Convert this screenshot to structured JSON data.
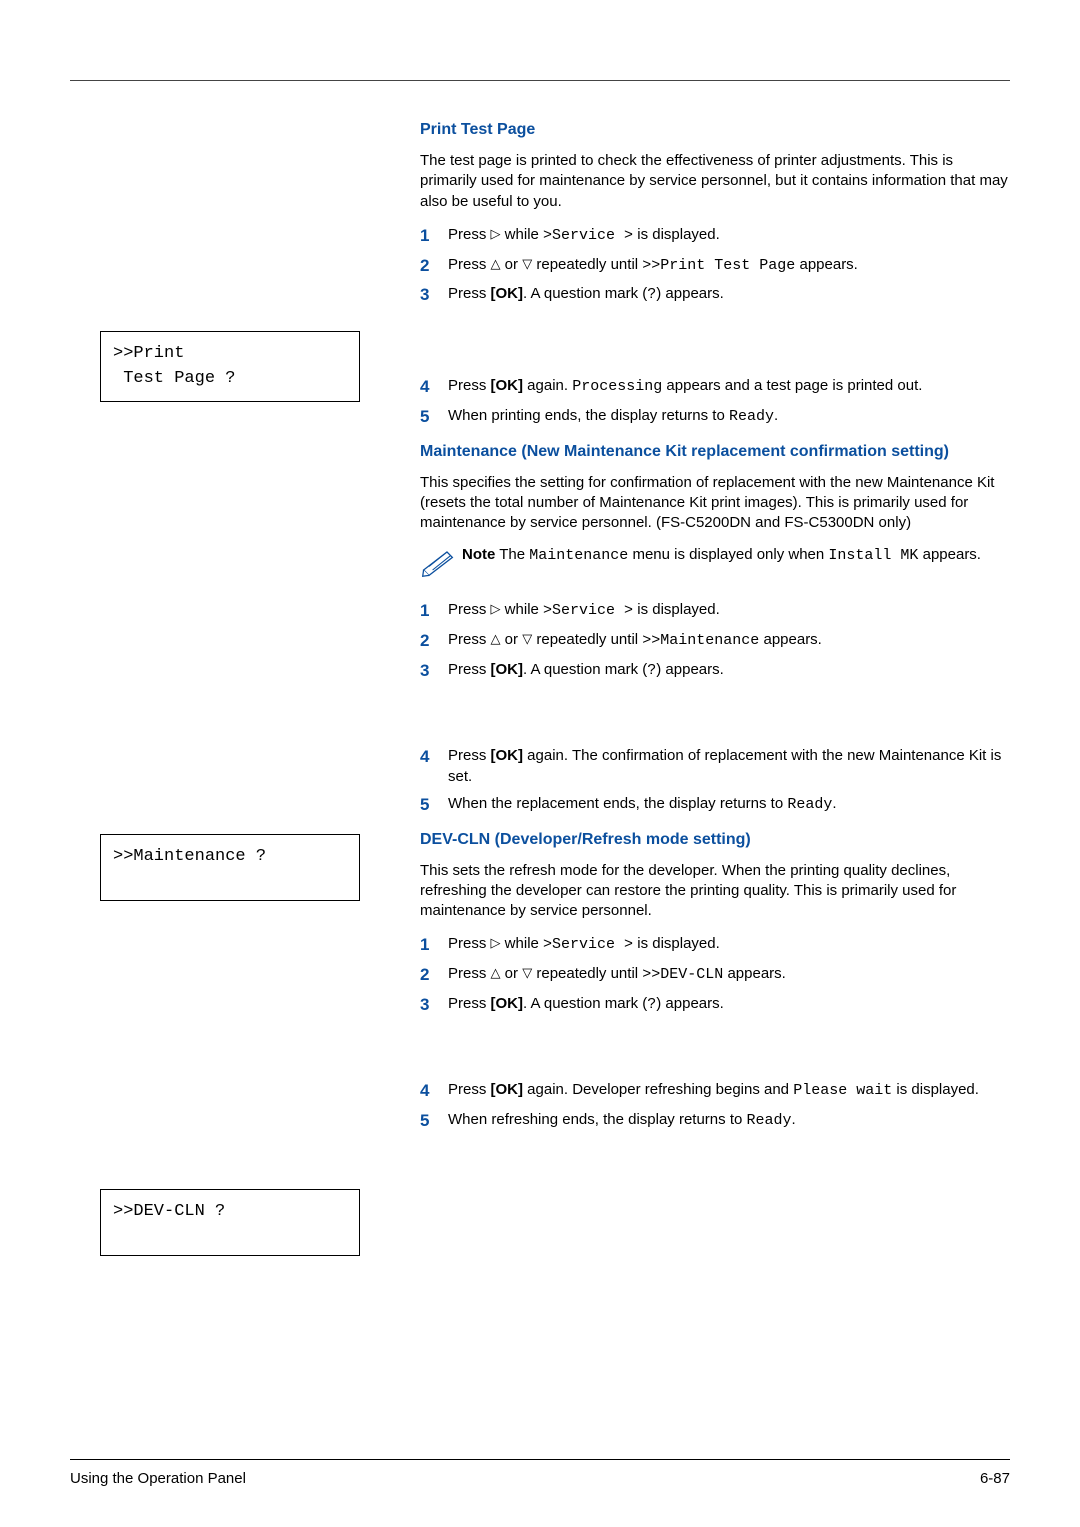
{
  "section1": {
    "heading": "Print Test Page",
    "intro": "The test page is printed to check the effectiveness of printer adjustments. This is primarily used for maintenance by service personnel, but it contains information that may also be useful to you.",
    "step1_a": "Press ",
    "step1_b": " while ",
    "step1_code": ">Service >",
    "step1_c": " is displayed.",
    "step2_a": "Press ",
    "step2_b": " or ",
    "step2_c": " repeatedly until ",
    "step2_code": ">>Print Test Page",
    "step2_d": " appears.",
    "step3_a": "Press ",
    "step3_bold": "[OK]",
    "step3_b": ". A question mark (",
    "step3_code": "?",
    "step3_c": ") appears.",
    "lcd": ">>Print\n Test Page ?",
    "step4_a": "Press ",
    "step4_bold": "[OK]",
    "step4_b": " again. ",
    "step4_code": "Processing",
    "step4_c": " appears and a test page is printed out.",
    "step5_a": "When printing ends, the display returns to ",
    "step5_code": "Ready",
    "step5_b": "."
  },
  "section2": {
    "heading": "Maintenance (New Maintenance Kit replacement confirmation setting)",
    "intro": "This specifies the setting for confirmation of replacement with the new Maintenance Kit (resets the total number of Maintenance Kit print images). This is primarily used for maintenance by service personnel. (FS-C5200DN and FS-C5300DN only)",
    "note_label": "Note",
    "note_a": " The ",
    "note_code1": "Maintenance",
    "note_b": " menu is displayed only when ",
    "note_code2": "Install MK",
    "note_c": " appears.",
    "step1_a": "Press ",
    "step1_b": " while ",
    "step1_code": ">Service >",
    "step1_c": " is displayed.",
    "step2_a": "Press ",
    "step2_b": " or ",
    "step2_c": " repeatedly until ",
    "step2_code": ">>Maintenance",
    "step2_d": " appears.",
    "step3_a": "Press ",
    "step3_bold": "[OK]",
    "step3_b": ". A question mark (",
    "step3_code": "?",
    "step3_c": ") appears.",
    "lcd": ">>Maintenance ?",
    "step4_a": "Press ",
    "step4_bold": "[OK]",
    "step4_b": " again. The confirmation of replacement with the new Maintenance Kit is set.",
    "step5_a": "When the replacement ends, the display returns to ",
    "step5_code": "Ready",
    "step5_b": "."
  },
  "section3": {
    "heading": "DEV-CLN (Developer/Refresh mode setting)",
    "intro": "This sets the refresh mode for the developer. When the printing quality declines, refreshing the developer can restore the printing quality. This is primarily used for maintenance by service personnel.",
    "step1_a": "Press ",
    "step1_b": " while ",
    "step1_code": ">Service >",
    "step1_c": " is displayed.",
    "step2_a": "Press ",
    "step2_b": " or ",
    "step2_c": " repeatedly until ",
    "step2_code": ">>DEV-CLN",
    "step2_d": " appears.",
    "step3_a": "Press ",
    "step3_bold": "[OK]",
    "step3_b": ". A question mark (",
    "step3_code": "?",
    "step3_c": ") appears.",
    "lcd": ">>DEV-CLN ?",
    "step4_a": "Press ",
    "step4_bold": "[OK]",
    "step4_b": " again. Developer refreshing begins and ",
    "step4_code": "Please wait",
    "step4_c": " is displayed.",
    "step5_a": "When refreshing ends, the display returns to ",
    "step5_code": "Ready",
    "step5_b": "."
  },
  "footer": {
    "left": "Using the Operation Panel",
    "right": "6-87"
  },
  "nums": {
    "n1": "1",
    "n2": "2",
    "n3": "3",
    "n4": "4",
    "n5": "5"
  },
  "tri": {
    "right": "▷",
    "up": "△",
    "down": "▽"
  }
}
